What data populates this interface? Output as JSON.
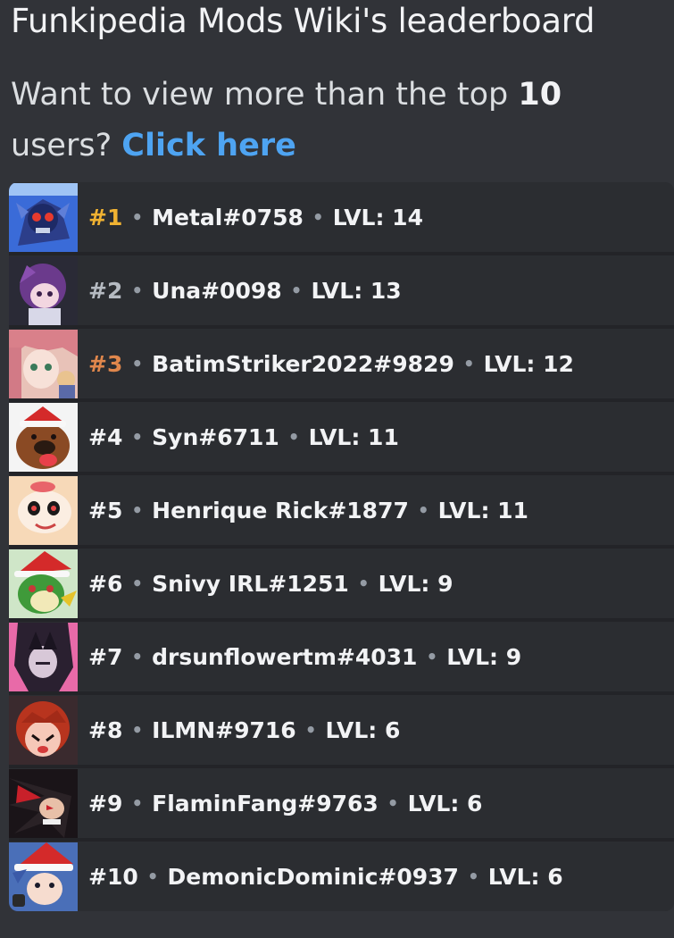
{
  "header": {
    "title": "Funkipedia Mods Wiki's leaderboard",
    "subtitle_prefix": "Want to view more than the top",
    "subtitle_count": "10",
    "subtitle_mid": "users?",
    "link_label": "Click here"
  },
  "colors": {
    "background": "#313338",
    "board": "#2b2d31",
    "link": "#4ea4f2",
    "gold": "#f0b232",
    "silver": "#b5bac1",
    "bronze": "#e0874c"
  },
  "separator": "•",
  "leaderboard": [
    {
      "rank": "#1",
      "username": "Metal#0758",
      "level": "LVL: 14",
      "avatar_icon": "metal-sonic-avatar-icon"
    },
    {
      "rank": "#2",
      "username": "Una#0098",
      "level": "LVL: 13",
      "avatar_icon": "purple-hair-girl-avatar-icon"
    },
    {
      "rank": "#3",
      "username": "BatimStriker2022#9829",
      "level": "LVL: 12",
      "avatar_icon": "pink-hair-girl-avatar-icon"
    },
    {
      "rank": "#4",
      "username": "Syn#6711",
      "level": "LVL: 11",
      "avatar_icon": "brown-dog-santa-hat-avatar-icon"
    },
    {
      "rank": "#5",
      "username": "Henrique Rick#1877",
      "level": "LVL: 11",
      "avatar_icon": "cuphead-avatar-icon"
    },
    {
      "rank": "#6",
      "username": "Snivy IRL#1251",
      "level": "LVL: 9",
      "avatar_icon": "snivy-santa-hat-avatar-icon"
    },
    {
      "rank": "#7",
      "username": "drsunflowertm#4031",
      "level": "LVL: 9",
      "avatar_icon": "dark-hair-pink-avatar-icon"
    },
    {
      "rank": "#8",
      "username": "ILMN#9716",
      "level": "LVL: 6",
      "avatar_icon": "red-hair-girl-avatar-icon"
    },
    {
      "rank": "#9",
      "username": "FlaminFang#9763",
      "level": "LVL: 6",
      "avatar_icon": "shadow-hedgehog-avatar-icon"
    },
    {
      "rank": "#10",
      "username": "DemonicDominic#0937",
      "level": "LVL: 6",
      "avatar_icon": "boyfriend-santa-hat-avatar-icon"
    }
  ]
}
